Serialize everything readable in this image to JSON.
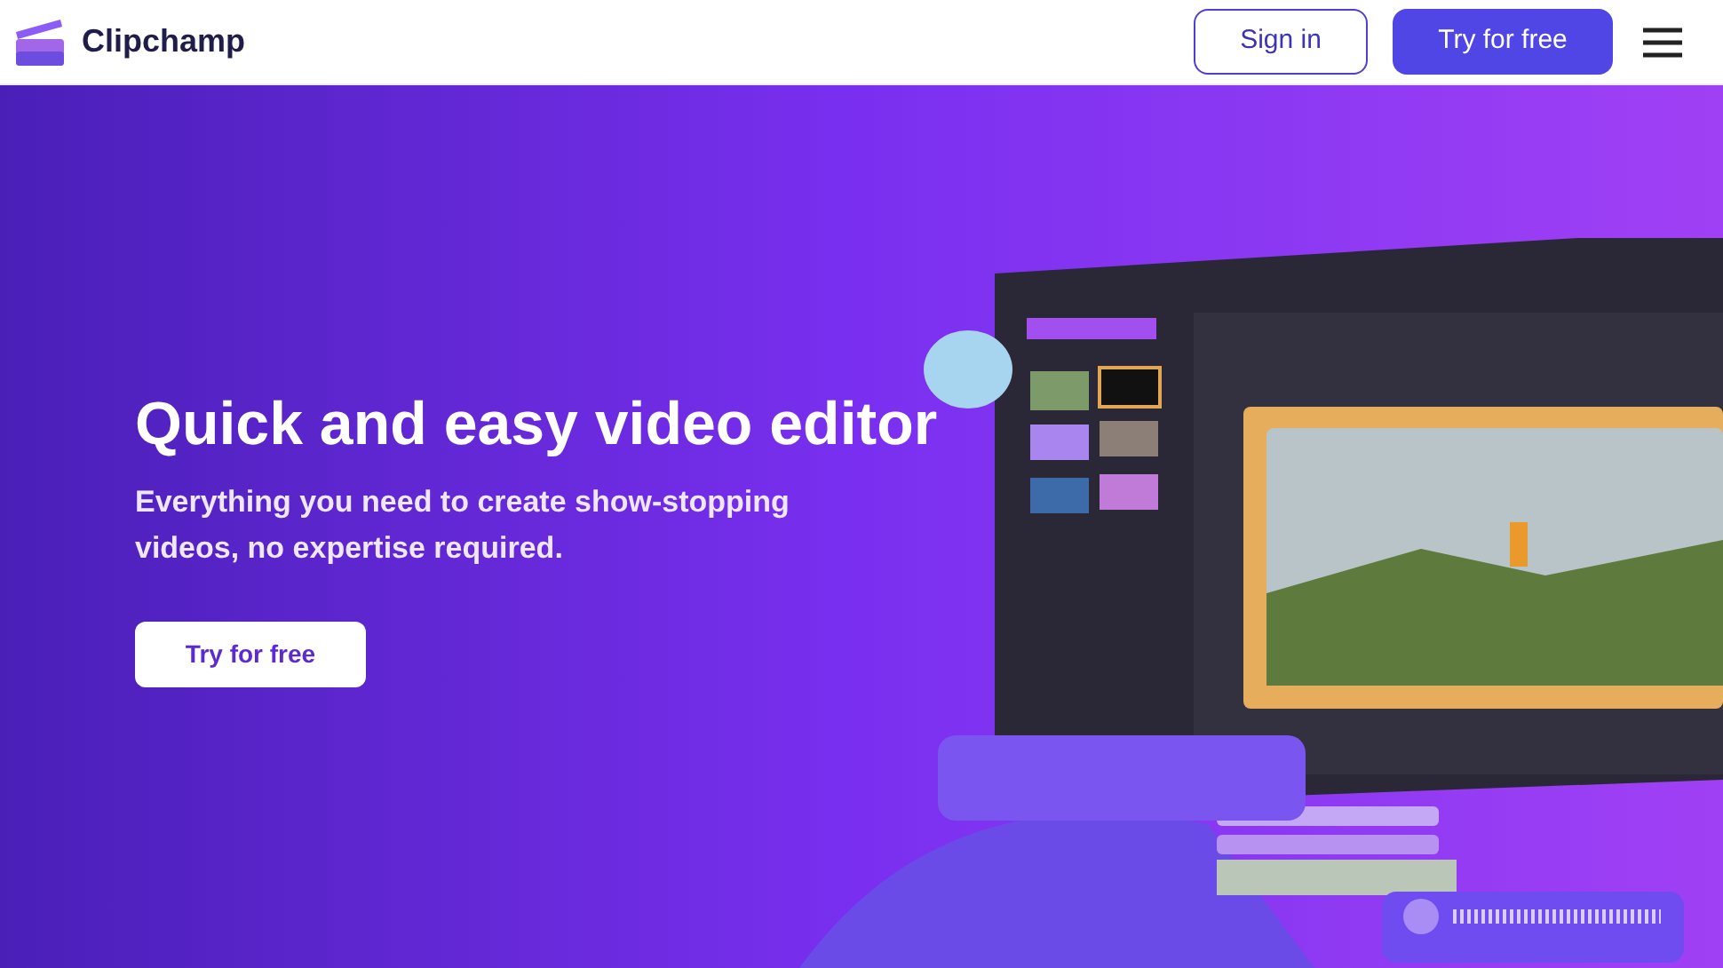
{
  "header": {
    "brand": "Clipchamp",
    "sign_in": "Sign in",
    "try_button": "Try for free"
  },
  "hero": {
    "title": "Quick and easy video editor",
    "subtitle": "Everything you need to create show-stopping videos, no expertise required.",
    "cta": "Try for free"
  }
}
